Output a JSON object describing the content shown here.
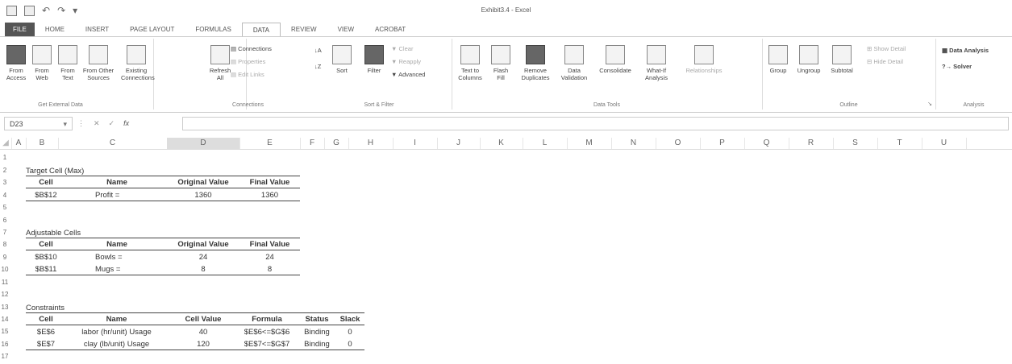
{
  "window_title": "Exhibit3.4 - Excel",
  "tabs": [
    "FILE",
    "HOME",
    "INSERT",
    "PAGE LAYOUT",
    "FORMULAS",
    "DATA",
    "REVIEW",
    "VIEW",
    "ACROBAT"
  ],
  "ribbon": {
    "get_external": {
      "from_access": "From Access",
      "from_web": "From Web",
      "from_text": "From Text",
      "from_other": "From Other Sources",
      "group": "Get External Data"
    },
    "existing": "Existing Connections",
    "connections": {
      "refresh": "Refresh All",
      "connections": "Connections",
      "properties": "Properties",
      "edit_links": "Edit Links",
      "group": "Connections"
    },
    "sort_filter": {
      "sort": "Sort",
      "filter": "Filter",
      "clear": "Clear",
      "reapply": "Reapply",
      "advanced": "Advanced",
      "group": "Sort & Filter"
    },
    "data_tools": {
      "text_to_columns": "Text to Columns",
      "flash_fill": "Flash Fill",
      "remove_duplicates": "Remove Duplicates",
      "data_validation": "Data Validation",
      "consolidate": "Consolidate",
      "what_if": "What-If Analysis",
      "relationships": "Relationships",
      "group": "Data Tools"
    },
    "outline": {
      "group_btn": "Group",
      "ungroup": "Ungroup",
      "subtotal": "Subtotal",
      "show_detail": "Show Detail",
      "hide_detail": "Hide Detail",
      "group": "Outline"
    },
    "analysis": {
      "data_analysis": "Data Analysis",
      "solver": "Solver",
      "group": "Analysis"
    }
  },
  "name_box": "D23",
  "fx": "fx",
  "columns": [
    "A",
    "B",
    "C",
    "D",
    "E",
    "F",
    "G",
    "H",
    "I",
    "J",
    "K",
    "L",
    "M",
    "N",
    "O",
    "P",
    "Q",
    "R",
    "S",
    "T",
    "U"
  ],
  "rows": [
    "1",
    "2",
    "3",
    "4",
    "5",
    "6",
    "7",
    "8",
    "9",
    "10",
    "11",
    "12",
    "13",
    "14",
    "15",
    "16",
    "17"
  ],
  "sheet": {
    "target_title": "Target Cell (Max)",
    "target_headers": [
      "Cell",
      "Name",
      "Original Value",
      "Final Value"
    ],
    "target_row": [
      "$B$12",
      "Profit =",
      "1360",
      "1360"
    ],
    "adj_title": "Adjustable Cells",
    "adj_headers": [
      "Cell",
      "Name",
      "Original Value",
      "Final Value"
    ],
    "adj_rows": [
      [
        "$B$10",
        "Bowls =",
        "24",
        "24"
      ],
      [
        "$B$11",
        "Mugs =",
        "8",
        "8"
      ]
    ],
    "con_title": "Constraints",
    "con_headers": [
      "Cell",
      "Name",
      "Cell Value",
      "Formula",
      "Status",
      "Slack"
    ],
    "con_rows": [
      [
        "$E$6",
        "labor (hr/unit) Usage",
        "40",
        "$E$6<=$G$6",
        "Binding",
        "0"
      ],
      [
        "$E$7",
        "clay (lb/unit) Usage",
        "120",
        "$E$7<=$G$7",
        "Binding",
        "0"
      ]
    ]
  }
}
